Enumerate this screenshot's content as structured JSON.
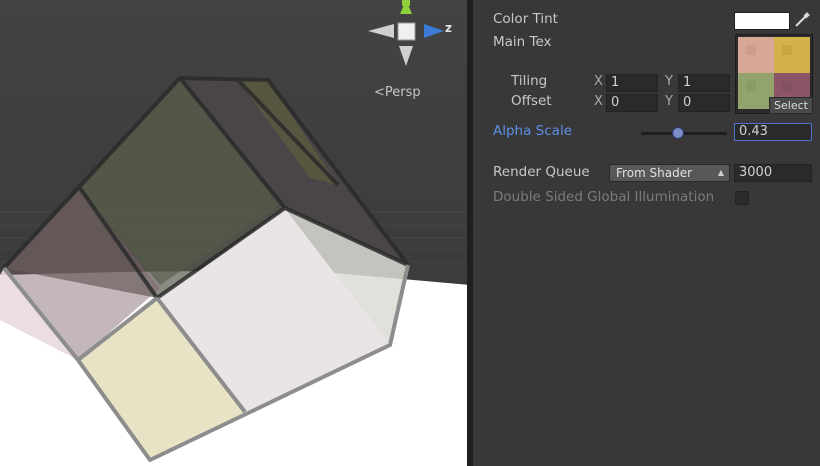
{
  "scene": {
    "projection_label": "Persp",
    "gizmo": {
      "z_axis_label": "z"
    }
  },
  "inspector": {
    "color_tint": {
      "label": "Color Tint",
      "value": "#ffffff"
    },
    "main_tex": {
      "label": "Main Tex",
      "select_label": "Select"
    },
    "tiling": {
      "label": "Tiling",
      "x_label": "X",
      "x": "1",
      "y_label": "Y",
      "y": "1"
    },
    "offset": {
      "label": "Offset",
      "x_label": "X",
      "x": "0",
      "y_label": "Y",
      "y": "0"
    },
    "alpha_scale": {
      "label": "Alpha Scale",
      "value": "0.43",
      "fraction": 0.43
    },
    "render_queue": {
      "label": "Render Queue",
      "dropdown": "From Shader",
      "value": "3000"
    },
    "double_sided_gi": {
      "label": "Double Sided Global Illumination",
      "checked": false
    }
  },
  "colors": {
    "accent": "#5d8fe6",
    "panel_bg": "#383838",
    "field_bg": "#2a2a2a"
  }
}
